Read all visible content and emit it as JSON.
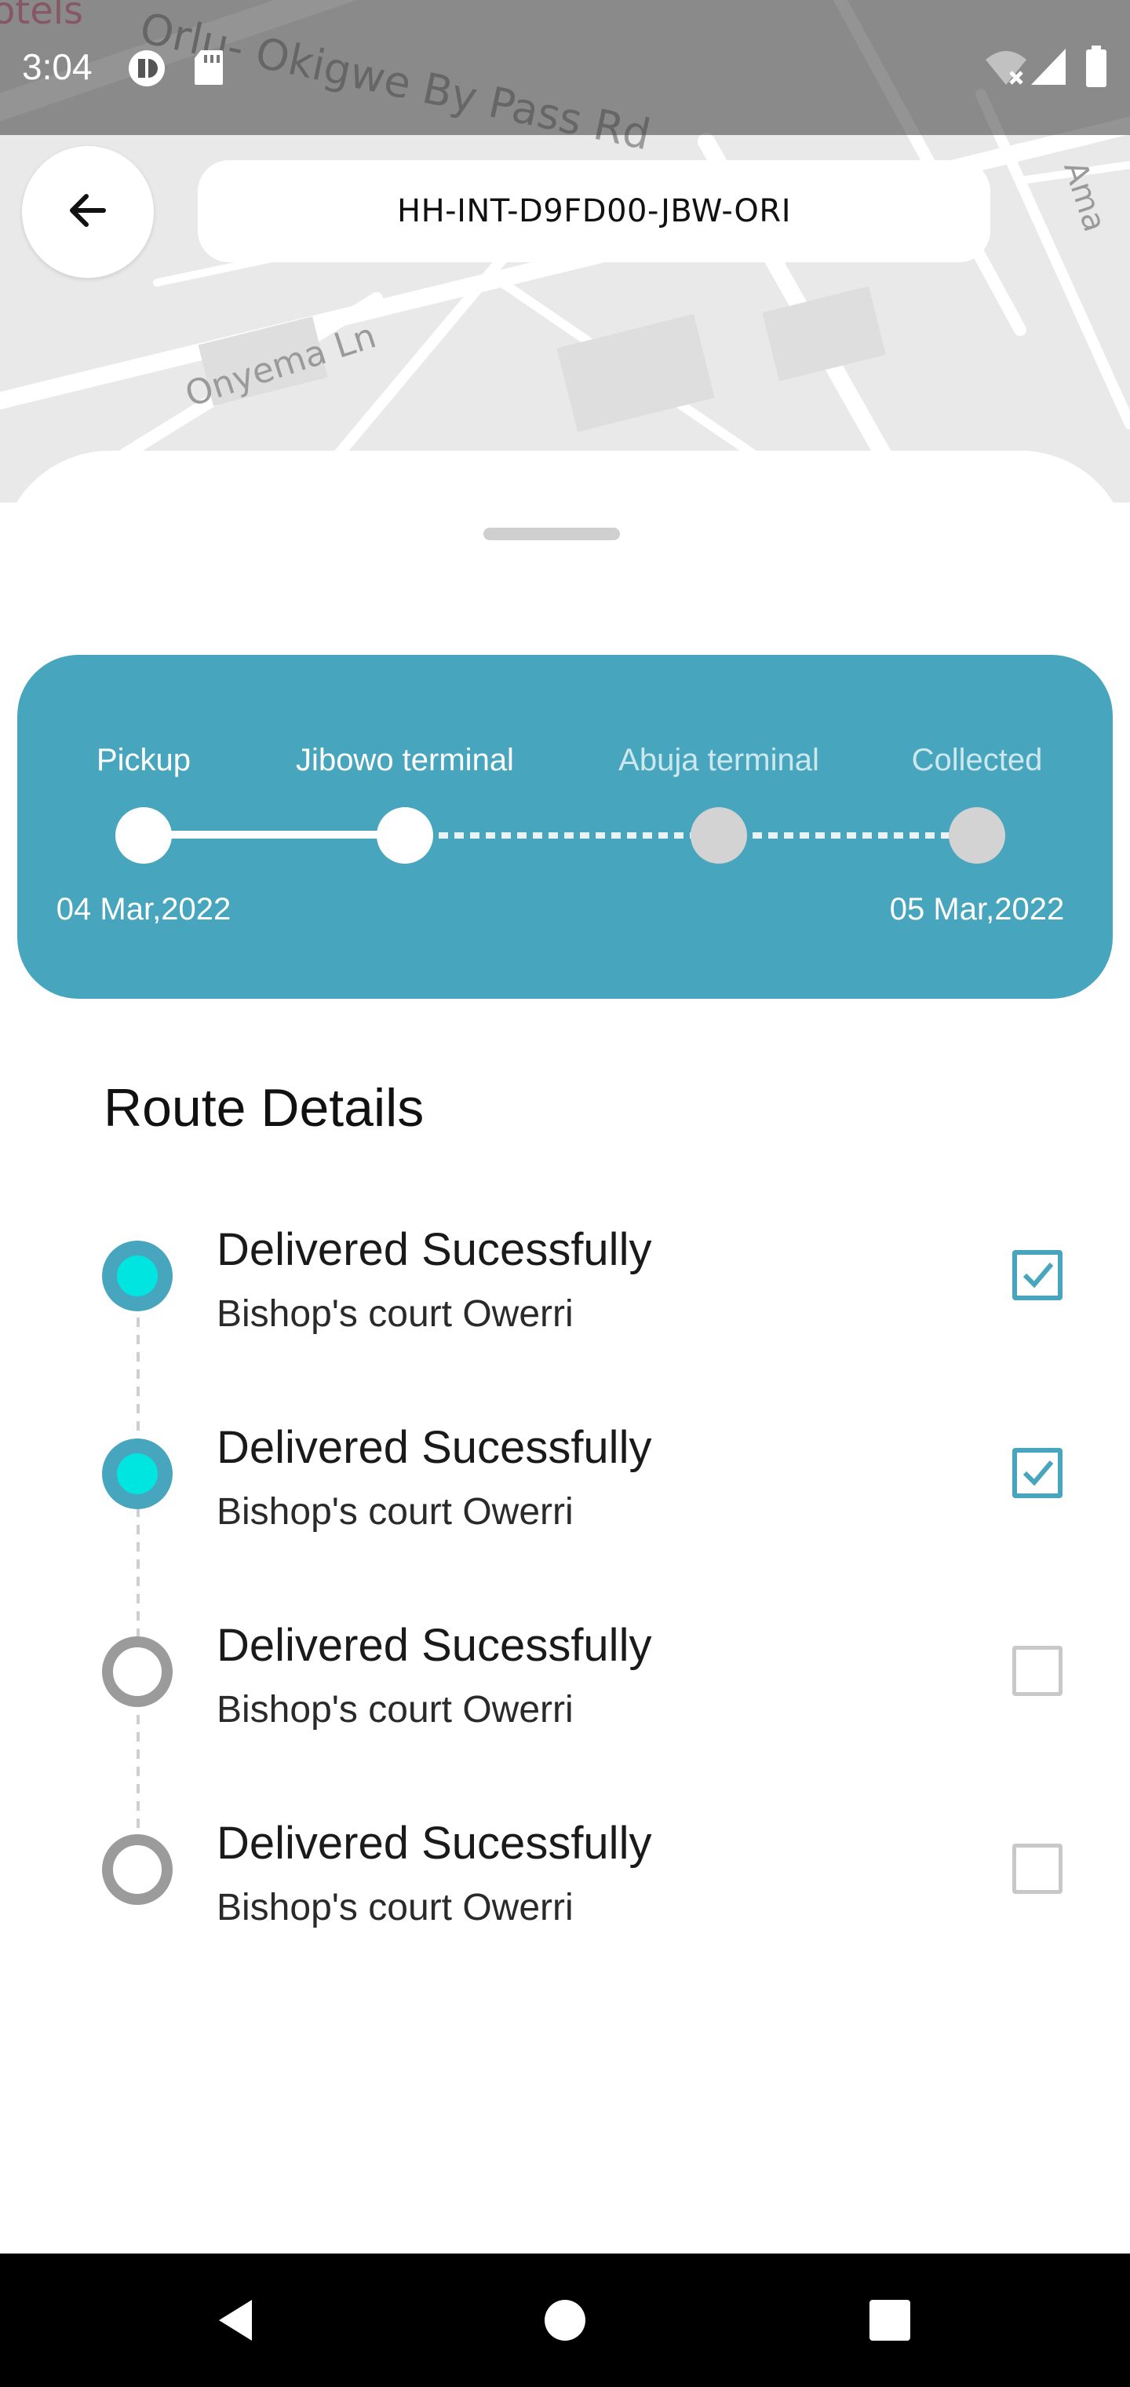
{
  "status_bar": {
    "time": "3:04",
    "icons": [
      "private-dns-icon",
      "sd-card-icon",
      "wifi-off-icon",
      "cell-signal-icon",
      "battery-icon"
    ]
  },
  "map": {
    "labels": {
      "top_left": "otels",
      "road_1": "Orlu- Okigwe By Pass Rd",
      "road_2": "Onyema Ln",
      "right_edge": "Ama"
    }
  },
  "header": {
    "back_icon": "arrow-left-icon",
    "tracking_id": "HH-INT-D9FD00-JBW-ORI"
  },
  "progress": {
    "stages": [
      {
        "label": "Pickup",
        "reached": true
      },
      {
        "label": "Jibowo terminal",
        "reached": true
      },
      {
        "label": "Abuja terminal",
        "reached": false
      },
      {
        "label": "Collected",
        "reached": false
      }
    ],
    "start_date": "04 Mar,2022",
    "end_date": "05 Mar,2022",
    "colors": {
      "card": "#47a6bd",
      "active": "#ffffff",
      "inactive": "#d3d3d3"
    }
  },
  "route": {
    "title": "Route Details",
    "items": [
      {
        "heading": "Delivered Sucessfully",
        "location": "Bishop's court Owerri",
        "done": true
      },
      {
        "heading": "Delivered Sucessfully",
        "location": "Bishop's court Owerri",
        "done": true
      },
      {
        "heading": "Delivered Sucessfully",
        "location": "Bishop's court Owerri",
        "done": false
      },
      {
        "heading": "Delivered Sucessfully",
        "location": "Bishop's court Owerri",
        "done": false
      }
    ],
    "colors": {
      "done": "#47a6bd",
      "done_inner": "#00e5e0",
      "pending": "#9b9b9b"
    }
  },
  "nav_bar": {
    "buttons": [
      "back-triangle-icon",
      "home-circle-icon",
      "recents-square-icon"
    ]
  }
}
